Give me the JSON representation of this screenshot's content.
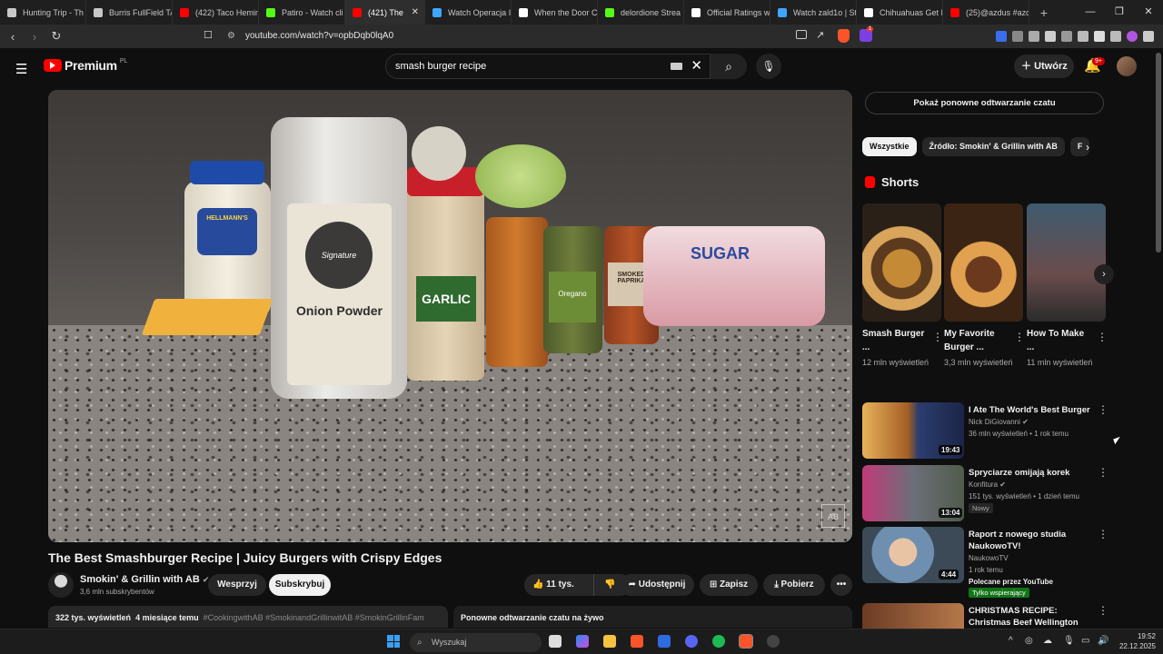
{
  "browser": {
    "tabs": [
      {
        "label": "Hunting Trip - Th",
        "color": "#c8c8c8"
      },
      {
        "label": "Burris FullField TA",
        "color": "#c8c8c8"
      },
      {
        "label": "(422) Taco Hemin",
        "color": "#ff0000"
      },
      {
        "label": "Patiro - Watch cli",
        "color": "#53fc18"
      },
      {
        "label": "(421) The",
        "color": "#ff0000",
        "active": true
      },
      {
        "label": "Watch Operacja I",
        "color": "#3ea6ff"
      },
      {
        "label": "When the Door C",
        "color": "#ffffff"
      },
      {
        "label": "delordione Strea",
        "color": "#53fc18"
      },
      {
        "label": "Official Ratings w",
        "color": "#ffffff"
      },
      {
        "label": "Watch zald1o | St",
        "color": "#3ea6ff"
      },
      {
        "label": "Chihuahuas Get I",
        "color": "#ffffff"
      },
      {
        "label": "(25)@azdus #azd",
        "color": "#ff0000"
      }
    ],
    "new_tab": "+",
    "url": "youtube.com/watch?v=opbDqb0lqA0",
    "ext_badge": "1"
  },
  "header": {
    "logo_text": "Premium",
    "logo_region": "PL",
    "search_value": "smash burger recipe",
    "create_label": "Utwórz",
    "notif_count": "9+"
  },
  "video": {
    "title": "The Best Smashburger Recipe | Juicy Burgers with Crispy Edges",
    "channel": "Smokin' & Grillin with AB",
    "subscribers": "3,6 mln subskrybentów",
    "support_label": "Wesprzyj",
    "subscribe_label": "Subskrybuj",
    "likes": "11 tys.",
    "share_label": "Udostępnij",
    "save_label": "Zapisz",
    "download_label": "Pobierz",
    "views": "322 tys. wyświetleń",
    "age": "4 miesiące temu",
    "tags": "#CookingwithAB #SmokinandGrillinwitAB #SmokinGrillinFam",
    "replay_chat_label": "Ponowne odtwarzanie czatu na żywo",
    "labels": {
      "onion": "Onion Powder",
      "garlic": "GARLIC",
      "sugar": "SUGAR",
      "hellmanns": "HELLMANN'S",
      "brand": "Signature",
      "oregano": "Oregano",
      "paprika": "SMOKED PAPRIKA"
    }
  },
  "sidebar": {
    "chat_replay_button": "Pokaż ponowne odtwarzanie czatu",
    "chips": [
      "Wszystkie",
      "Źródło: Smokin' & Grillin with AB",
      "F"
    ],
    "shorts_title": "Shorts",
    "shorts": [
      {
        "title": "Smash Burger ...",
        "views": "12 mln wyświetleń"
      },
      {
        "title": "My Favorite Burger ...",
        "views": "3,3 mln wyświetleń"
      },
      {
        "title": "How To Make ...",
        "views": "11 mln wyświetleń"
      }
    ],
    "recommendations": [
      {
        "title": "I Ate The World's Best Burger",
        "channel": "Nick DiGiovanni",
        "meta": "36 mln wyświetleń • 1 rok temu",
        "duration": "19:43"
      },
      {
        "title": "Spryciarze omijają korek",
        "channel": "Konfitura",
        "meta": "151 tys. wyświetleń • 1 dzień temu",
        "duration": "13:04",
        "tag": "Nowy"
      },
      {
        "title": "Raport z nowego studia NaukowoTV!",
        "channel": "NaukowoTV",
        "meta": "1 rok temu",
        "duration": "4:44",
        "extra": "Polecane przez YouTube",
        "tag": "Tylko wspierający"
      },
      {
        "title": "CHRISTMAS RECIPE: Christmas Beef Wellington"
      }
    ]
  },
  "taskbar": {
    "search_placeholder": "Wyszukaj",
    "time": "19:52",
    "date": "22.12.2025"
  }
}
